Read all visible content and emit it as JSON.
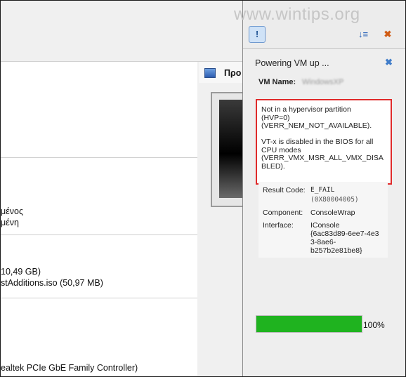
{
  "watermark": "www.wintips.org",
  "main": {
    "preview_title": "Προ",
    "details": [
      "μένος",
      "μένη",
      "10,49 GB)",
      "stAdditions.iso (50,97 MB)",
      "ealtek PCIe GbE Family Controller)"
    ]
  },
  "panel": {
    "toolbar_icons": [
      "notification-bubble-icon",
      "sort-icon",
      "clear-all-icon"
    ],
    "card": {
      "title": "Powering VM up ...",
      "close_glyph": "✖",
      "vm_name_label": "VM Name:",
      "vm_name_value": "WindowsXP",
      "error_message": "Not in a hypervisor partition\n(HVP=0)\n(VERR_NEM_NOT_AVAILABLE).\n\nVT-x is disabled in the BIOS for all\nCPU modes\n(VERR_VMX_MSR_ALL_VMX_DISA\nBLED).",
      "result_code_label": "Result Code:",
      "result_code_value": "E_FAIL",
      "result_code_hex": "(0X80004005)",
      "component_label": "Component:",
      "component_value": "ConsoleWrap",
      "interface_label": "Interface:",
      "interface_value": "IConsole\n{6ac83d89-6ee7-4e3\n3-8ae6-\nb257b2e81be8}",
      "progress_percent": 100,
      "progress_label": "100%"
    }
  },
  "colors": {
    "error_border": "#e02b2b",
    "progress_fill": "#1fb31f",
    "close_icon": "#3f7cc9"
  }
}
